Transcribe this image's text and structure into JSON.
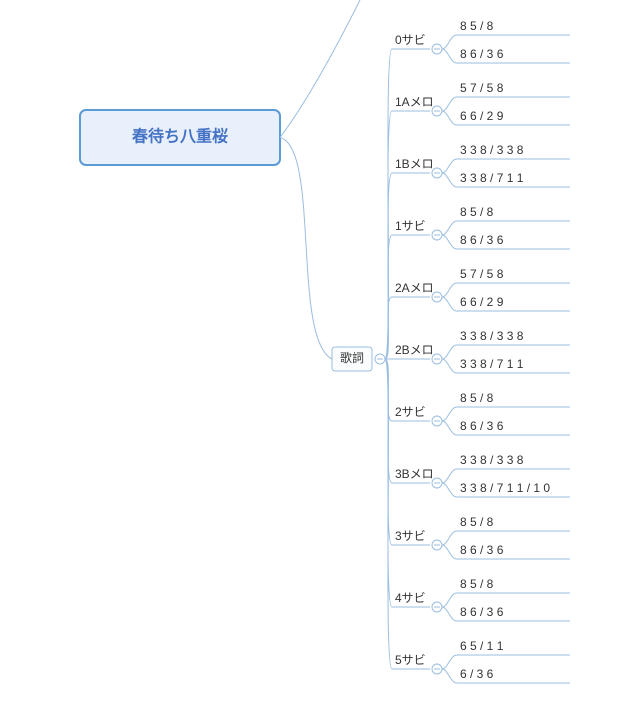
{
  "root": {
    "title": "春待ち八重桜"
  },
  "kashi": {
    "label": "歌詞"
  },
  "sections": [
    {
      "label": "0サビ",
      "leaves": [
        "8 5 / 8",
        "8 6 / 3 6"
      ]
    },
    {
      "label": "1Aメロ",
      "leaves": [
        "5 7 / 5 8",
        "6 6 / 2 9"
      ]
    },
    {
      "label": "1Bメロ",
      "leaves": [
        "3 3 8 / 3 3 8",
        "3 3 8 / 7 1 1"
      ]
    },
    {
      "label": "1サビ",
      "leaves": [
        "8 5 / 8",
        "8 6 / 3 6"
      ]
    },
    {
      "label": "2Aメロ",
      "leaves": [
        "5 7 / 5 8",
        "6 6 / 2 9"
      ]
    },
    {
      "label": "2Bメロ",
      "leaves": [
        "3 3 8 / 3 3 8",
        "3 3 8 / 7 1 1"
      ]
    },
    {
      "label": "2サビ",
      "leaves": [
        "8 5 / 8",
        "8 6 / 3 6"
      ]
    },
    {
      "label": "3Bメロ",
      "leaves": [
        "3 3 8 / 3 3 8",
        "3 3 8 / 7 1 1 / 1 0"
      ]
    },
    {
      "label": "3サビ",
      "leaves": [
        "8 5 / 8",
        "8 6 / 3 6"
      ]
    },
    {
      "label": "4サビ",
      "leaves": [
        "8 5 / 8",
        "8 6 / 3 6"
      ]
    },
    {
      "label": "5サビ",
      "leaves": [
        "6 5 / 1 1",
        "6 / 3 6"
      ]
    }
  ]
}
